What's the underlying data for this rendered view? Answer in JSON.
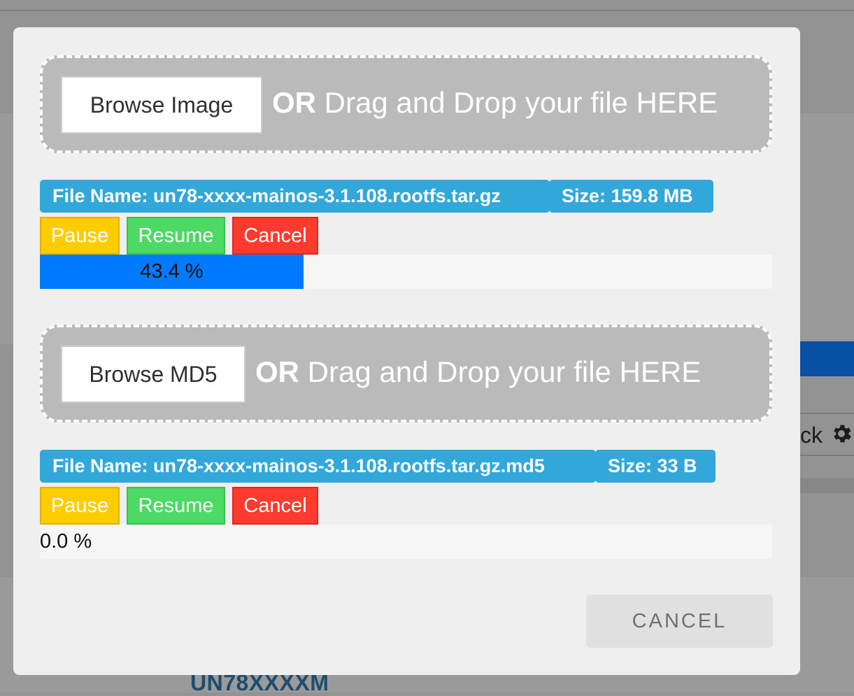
{
  "background": {
    "track_text": "ck",
    "device_title": "UN78XXXXM"
  },
  "uploads": [
    {
      "browse_label": "Browse Image",
      "drop_or": "OR",
      "drop_text": "Drag and Drop your file HERE",
      "file_name": "File Name: un78-xxxx-mainos-3.1.108.rootfs.tar.gz",
      "file_size": "Size: 159.8 MB",
      "pause_label": "Pause",
      "resume_label": "Resume",
      "cancel_label": "Cancel",
      "progress_percent": 36,
      "progress_text": "43.4 %"
    },
    {
      "browse_label": "Browse MD5",
      "drop_or": "OR",
      "drop_text": "Drag and Drop your file HERE",
      "file_name": "File Name: un78-xxxx-mainos-3.1.108.rootfs.tar.gz.md5",
      "file_size": "Size: 33 B",
      "pause_label": "Pause",
      "resume_label": "Resume",
      "cancel_label": "Cancel",
      "progress_percent": 0,
      "progress_text": "0.0 %"
    }
  ],
  "footer": {
    "cancel_label": "CANCEL"
  },
  "colors": {
    "pause": "#ffcc00",
    "resume": "#4cd964",
    "cancel": "#ff3b30",
    "chip": "#31a7da",
    "progress": "#007aff"
  },
  "icons": {
    "settings": "gear-icon"
  }
}
